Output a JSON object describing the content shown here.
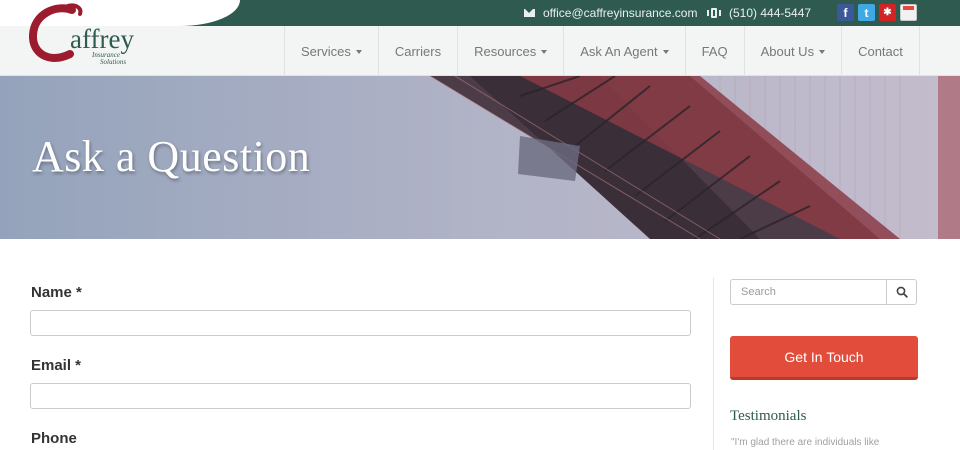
{
  "brand": {
    "logo_text": "affrey",
    "logo_initial": "C",
    "logo_tagline_1": "Insurance",
    "logo_tagline_2": "Solutions",
    "accent": "#2f5a50",
    "logo_red": "#9b1b2f"
  },
  "topbar": {
    "email": "office@caffreyinsurance.com",
    "phone": "(510) 444-5447",
    "social": [
      {
        "name": "facebook",
        "glyph": "f"
      },
      {
        "name": "twitter",
        "glyph": "t"
      },
      {
        "name": "yelp",
        "glyph": "✱"
      },
      {
        "name": "mail",
        "glyph": ""
      }
    ]
  },
  "nav": {
    "items": [
      {
        "label": "Services",
        "dropdown": true
      },
      {
        "label": "Carriers",
        "dropdown": false
      },
      {
        "label": "Resources",
        "dropdown": true
      },
      {
        "label": "Ask An Agent",
        "dropdown": true
      },
      {
        "label": "FAQ",
        "dropdown": false
      },
      {
        "label": "About Us",
        "dropdown": true
      },
      {
        "label": "Contact",
        "dropdown": false
      }
    ]
  },
  "hero": {
    "title": "Ask a Question"
  },
  "form": {
    "name_label": "Name *",
    "name_value": "",
    "email_label": "Email *",
    "email_value": "",
    "phone_label": "Phone"
  },
  "sidebar": {
    "search_placeholder": "Search",
    "cta_label": "Get In Touch",
    "cta_color": "#e14c3b",
    "testimonials_heading": "Testimonials",
    "testimonial_snippet": "\"I'm glad there are individuals like"
  }
}
